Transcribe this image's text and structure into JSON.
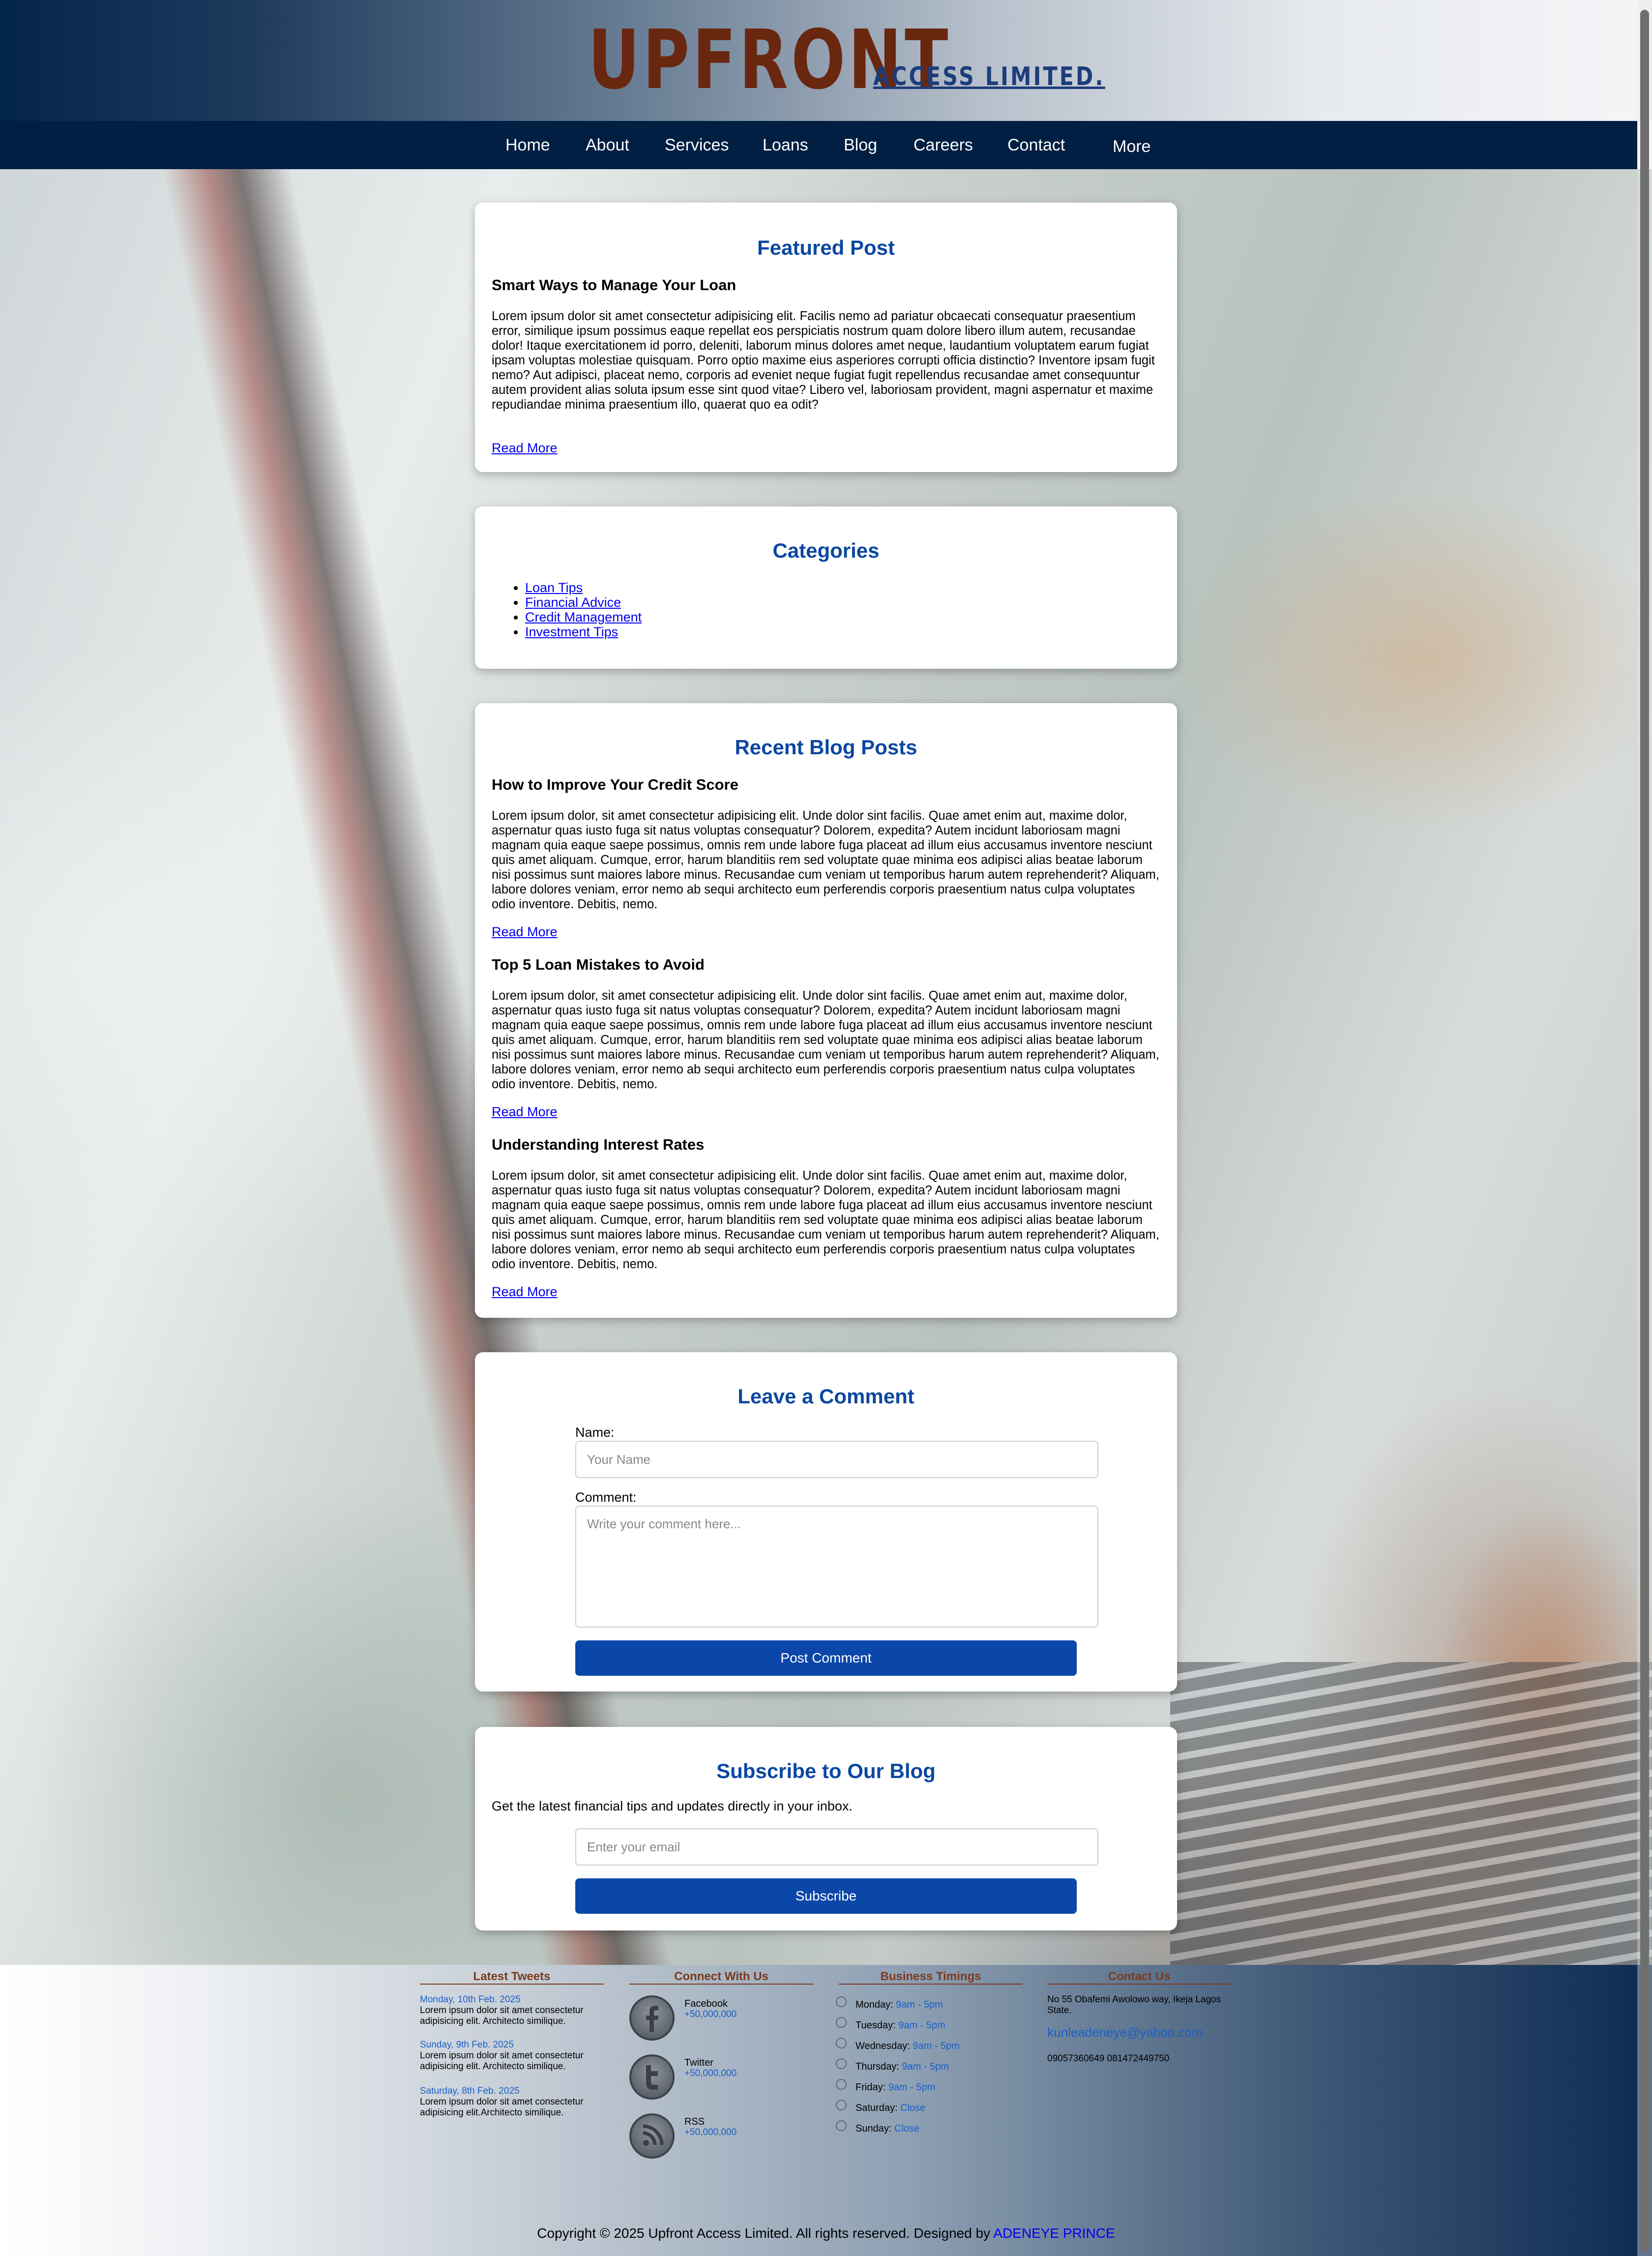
{
  "brand": {
    "name": "UPFRONT",
    "suffix": "ACCESS LIMITED."
  },
  "nav": [
    "Home",
    "About",
    "Services",
    "Loans",
    "Blog",
    "Careers",
    "Contact",
    "More"
  ],
  "featured": {
    "heading": "Featured Post",
    "title": "Smart Ways to Manage Your Loan",
    "body": "Lorem ipsum dolor sit amet consectetur adipisicing elit. Facilis nemo ad pariatur obcaecati consequatur praesentium error, similique ipsum possimus eaque repellat eos perspiciatis nostrum quam dolore libero illum autem, recusandae dolor! Itaque exercitationem id porro, deleniti, laborum minus dolores amet neque, laudantium voluptatem earum fugiat ipsam voluptas molestiae quisquam. Porro optio maxime eius asperiores corrupti officia distinctio? Inventore ipsam fugit nemo? Aut adipisci, placeat nemo, corporis ad eveniet neque fugiat fugit repellendus recusandae amet consequuntur autem provident alias soluta ipsum esse sint quod vitae? Libero vel, laboriosam provident, magni aspernatur et maxime repudiandae minima praesentium illo, quaerat quo ea odit?",
    "read_more": "Read More"
  },
  "categories": {
    "heading": "Categories",
    "items": [
      "Loan Tips",
      "Financial Advice",
      "Credit Management",
      "Investment Tips"
    ]
  },
  "recent": {
    "heading": "Recent Blog Posts",
    "posts": [
      {
        "title": "How to Improve Your Credit Score",
        "body": "Lorem ipsum dolor, sit amet consectetur adipisicing elit. Unde dolor sint facilis. Quae amet enim aut, maxime dolor, aspernatur quas iusto fuga sit natus voluptas consequatur? Dolorem, expedita? Autem incidunt laboriosam magni magnam quia eaque saepe possimus, omnis rem unde labore fuga placeat ad illum eius accusamus inventore nesciunt quis amet aliquam. Cumque, error, harum blanditiis rem sed voluptate quae minima eos adipisci alias beatae laborum nisi possimus sunt maiores labore minus. Recusandae cum veniam ut temporibus harum autem reprehenderit? Aliquam, labore dolores veniam, error nemo ab sequi architecto eum perferendis corporis praesentium natus culpa voluptates odio inventore. Debitis, nemo.",
        "read_more": "Read More"
      },
      {
        "title": "Top 5 Loan Mistakes to Avoid",
        "body": "Lorem ipsum dolor, sit amet consectetur adipisicing elit. Unde dolor sint facilis. Quae amet enim aut, maxime dolor, aspernatur quas iusto fuga sit natus voluptas consequatur? Dolorem, expedita? Autem incidunt laboriosam magni magnam quia eaque saepe possimus, omnis rem unde labore fuga placeat ad illum eius accusamus inventore nesciunt quis amet aliquam. Cumque, error, harum blanditiis rem sed voluptate quae minima eos adipisci alias beatae laborum nisi possimus sunt maiores labore minus. Recusandae cum veniam ut temporibus harum autem reprehenderit? Aliquam, labore dolores veniam, error nemo ab sequi architecto eum perferendis corporis praesentium natus culpa voluptates odio inventore. Debitis, nemo.",
        "read_more": "Read More"
      },
      {
        "title": "Understanding Interest Rates",
        "body": "Lorem ipsum dolor, sit amet consectetur adipisicing elit. Unde dolor sint facilis. Quae amet enim aut, maxime dolor, aspernatur quas iusto fuga sit natus voluptas consequatur? Dolorem, expedita? Autem incidunt laboriosam magni magnam quia eaque saepe possimus, omnis rem unde labore fuga placeat ad illum eius accusamus inventore nesciunt quis amet aliquam. Cumque, error, harum blanditiis rem sed voluptate quae minima eos adipisci alias beatae laborum nisi possimus sunt maiores labore minus. Recusandae cum veniam ut temporibus harum autem reprehenderit? Aliquam, labore dolores veniam, error nemo ab sequi architecto eum perferendis corporis praesentium natus culpa voluptates odio inventore. Debitis, nemo.",
        "read_more": "Read More"
      }
    ]
  },
  "comment": {
    "heading": "Leave a Comment",
    "name_label": "Name:",
    "name_placeholder": "Your Name",
    "comment_label": "Comment:",
    "comment_placeholder": "Write your comment here...",
    "button": "Post Comment"
  },
  "subscribe": {
    "heading": "Subscribe to Our Blog",
    "text": "Get the latest financial tips and updates directly in your inbox.",
    "email_placeholder": "Enter your email",
    "button": "Subscribe"
  },
  "footer": {
    "tweets": {
      "title": "Latest Tweets",
      "items": [
        {
          "date": "Monday, 10th Feb. 2025",
          "text": "Lorem ipsum dolor sit amet consectetur adipisicing elit. Architecto similique."
        },
        {
          "date": "Sunday, 9th Feb. 2025",
          "text": "Lorem ipsum dolor sit amet consectetur adipisicing elit. Architecto similique."
        },
        {
          "date": "Saturday, 8th Feb. 2025",
          "text": "Lorem ipsum dolor sit amet consectetur adipisicing elit.Architecto similique."
        }
      ]
    },
    "connect": {
      "title": "Connect With Us",
      "items": [
        {
          "name": "Facebook",
          "count": "+50,000,000",
          "icon": "facebook-icon"
        },
        {
          "name": "Twitter",
          "count": "+50,000,000",
          "icon": "twitter-icon"
        },
        {
          "name": "RSS",
          "count": "+50,000,000",
          "icon": "rss-icon"
        }
      ]
    },
    "timings": {
      "title": "Business Timings",
      "items": [
        {
          "day": "Monday:",
          "time": "9am - 5pm"
        },
        {
          "day": "Tuesday:",
          "time": "9am - 5pm"
        },
        {
          "day": "Wednesday:",
          "time": "9am - 5pm"
        },
        {
          "day": "Thursday:",
          "time": "9am - 5pm"
        },
        {
          "day": "Friday:",
          "time": "9am - 5pm"
        },
        {
          "day": "Saturday:",
          "time": "Close"
        },
        {
          "day": "Sunday:",
          "time": "Close"
        }
      ]
    },
    "contact": {
      "title": "Contact Us",
      "address": "No 55 Obafemi Awolowo way, Ikeja Lagos State.",
      "email": "kunleadeneye@yahoo.com",
      "phones": "09057360649 081472449750"
    },
    "copyright": "Copyright © 2025 Upfront Access Limited. All rights reserved. Designed by",
    "designer": "ADENEYE PRINCE"
  },
  "colors": {
    "accent": "#0b47a1",
    "nav_bg": "#001f42",
    "logo": "#6a2710",
    "footer_title": "#7b3a1e"
  }
}
